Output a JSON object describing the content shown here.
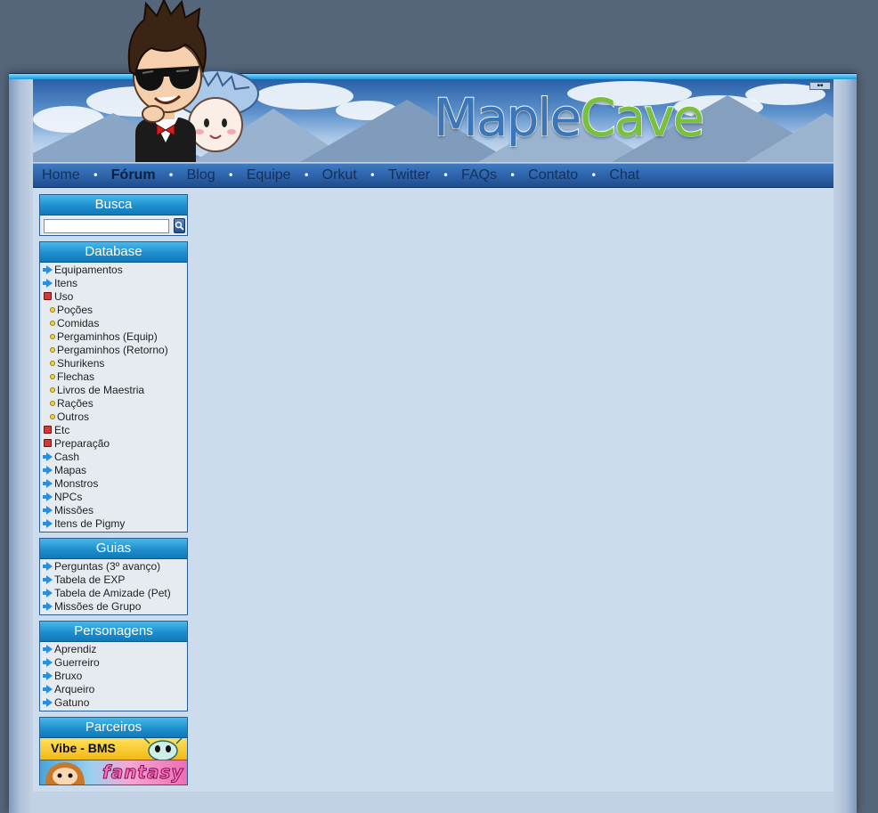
{
  "header": {
    "logo_part1": "Maple",
    "logo_part2": "Cave"
  },
  "nav": {
    "items": [
      "Home",
      "Fórum",
      "Blog",
      "Equipe",
      "Orkut",
      "Twitter",
      "FAQs",
      "Contato",
      "Chat"
    ],
    "active": "Fórum",
    "separator": "•"
  },
  "sidebar": {
    "busca": {
      "title": "Busca",
      "placeholder": ""
    },
    "database": {
      "title": "Database",
      "items": [
        {
          "label": "Equipamentos",
          "icon": "arrow-icon"
        },
        {
          "label": "Itens",
          "icon": "arrow-icon"
        },
        {
          "label": "Uso",
          "icon": "expanded-square-icon"
        },
        {
          "label": "Poções",
          "icon": "bullet-icon"
        },
        {
          "label": "Comidas",
          "icon": "bullet-icon"
        },
        {
          "label": "Pergaminhos (Equip)",
          "icon": "bullet-icon"
        },
        {
          "label": "Pergaminhos (Retorno)",
          "icon": "bullet-icon"
        },
        {
          "label": "Shurikens",
          "icon": "bullet-icon"
        },
        {
          "label": "Flechas",
          "icon": "bullet-icon"
        },
        {
          "label": "Livros de Maestria",
          "icon": "bullet-icon"
        },
        {
          "label": "Rações",
          "icon": "bullet-icon"
        },
        {
          "label": "Outros",
          "icon": "bullet-icon"
        },
        {
          "label": "Etc",
          "icon": "expanded-square-icon"
        },
        {
          "label": "Preparação",
          "icon": "expanded-square-icon"
        },
        {
          "label": "Cash",
          "icon": "arrow-icon"
        },
        {
          "label": "Mapas",
          "icon": "arrow-icon"
        },
        {
          "label": "Monstros",
          "icon": "arrow-icon"
        },
        {
          "label": "NPCs",
          "icon": "arrow-icon"
        },
        {
          "label": "Missões",
          "icon": "arrow-icon"
        },
        {
          "label": "Itens de Pigmy",
          "icon": "arrow-icon"
        }
      ]
    },
    "guias": {
      "title": "Guias",
      "items": [
        "Perguntas (3º avanço)",
        "Tabela de EXP",
        "Tabela de Amizade (Pet)",
        "Missões de Grupo"
      ]
    },
    "personagens": {
      "title": "Personagens",
      "items": [
        "Aprendiz",
        "Guerreiro",
        "Bruxo",
        "Arqueiro",
        "Gatuno"
      ]
    },
    "parceiros": {
      "title": "Parceiros",
      "ads": [
        "Vibe - BMS",
        "fantasy"
      ]
    }
  },
  "colors": {
    "page_bg": "#56667a",
    "content_bg": "#cddcec",
    "box_title": "#1d8fce",
    "nav_bg": "#2d62aa"
  }
}
